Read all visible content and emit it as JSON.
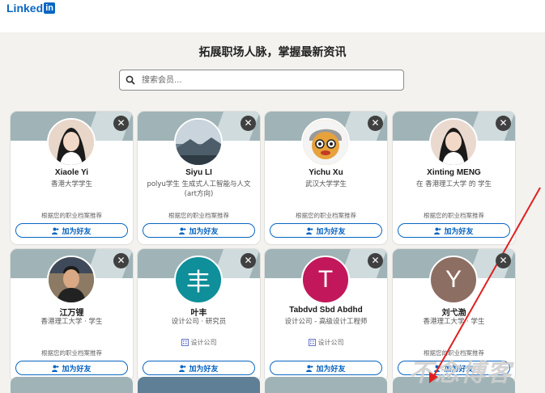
{
  "header": {
    "logo_text": "Linked",
    "logo_in": "in"
  },
  "page": {
    "title": "拓展职场人脉，掌握最新资讯"
  },
  "search": {
    "placeholder": "搜索会员..."
  },
  "cards": [
    {
      "name": "Xiaole Yi",
      "headline": "香港大学学生",
      "company": "",
      "reason": "根据您的职业档案推荐",
      "connect_label": "加为好友",
      "avatar": "photo-woman",
      "avatar_color": "#e8d6c9"
    },
    {
      "name": "Siyu LI",
      "headline": "polyu学生 生成式人工智能与人文(art方向)",
      "company": "",
      "reason": "根据您的职业档案推荐",
      "connect_label": "加为好友",
      "avatar": "photo-landscape",
      "avatar_color": "#8fa5b5"
    },
    {
      "name": "Yichu Xu",
      "headline": "武汉大学学生",
      "company": "",
      "reason": "根据您的职业档案推荐",
      "connect_label": "加为好友",
      "avatar": "photo-cartoon",
      "avatar_color": "#e7a23c"
    },
    {
      "name": "Xinting MENG",
      "headline": "在 香港理工大学 的 学生",
      "company": "",
      "reason": "根据您的职业档案推荐",
      "connect_label": "加为好友",
      "avatar": "photo-woman2",
      "avatar_color": "#ead9cf"
    },
    {
      "name": "江万锂",
      "headline": "香港理工大学 · 学生",
      "company": "",
      "reason": "根据您的职业档案推荐",
      "connect_label": "加为好友",
      "avatar": "photo-man",
      "avatar_color": "#7c6a55"
    },
    {
      "name": "叶丰",
      "headline": "设计公司 · 研究员",
      "company": "设计公司",
      "reason": "",
      "connect_label": "加为好友",
      "avatar": "letter",
      "avatar_letter": "丰",
      "avatar_color": "#0e8f9a"
    },
    {
      "name": "Tabdvd Sbd Abdhd",
      "headline": "设计公司 - 高级设计工程师",
      "company": "设计公司",
      "reason": "",
      "connect_label": "加为好友",
      "avatar": "letter",
      "avatar_letter": "T",
      "avatar_color": "#c2185b"
    },
    {
      "name": "刘弋渤",
      "headline": "香港理工大学 · 学生",
      "company": "",
      "reason": "根据您的职业档案推荐",
      "connect_label": "加为好友",
      "avatar": "letter",
      "avatar_letter": "Y",
      "avatar_color": "#8d6e63"
    }
  ],
  "dismiss_label": "✕",
  "watermark": "不念博客",
  "colors": {
    "brand": "#0a66c2",
    "annotation_arrow": "#e02020",
    "card_banner": "#a0b4b7"
  }
}
